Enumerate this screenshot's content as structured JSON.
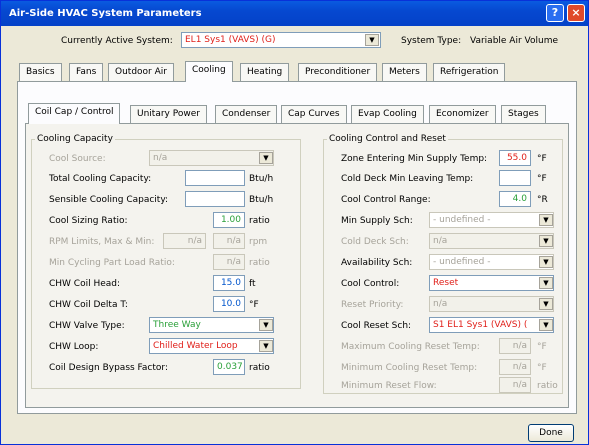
{
  "window": {
    "title": "Air-Side HVAC System Parameters",
    "help": "?",
    "close": "×"
  },
  "header": {
    "active_label": "Currently Active System:",
    "active_value": "EL1 Sys1 (VAVS) (G)",
    "type_label": "System Type:",
    "type_value": "Variable Air Volume"
  },
  "main_tabs": [
    "Basics",
    "Fans",
    "Outdoor Air",
    "Cooling",
    "Heating",
    "Preconditioner",
    "Meters",
    "Refrigeration"
  ],
  "sub_tabs": [
    "Coil Cap / Control",
    "Unitary Power",
    "Condenser",
    "Cap Curves",
    "Evap Cooling",
    "Economizer",
    "Stages"
  ],
  "left": {
    "title": "Cooling Capacity",
    "cool_source": {
      "label": "Cool Source:",
      "value": "n/a"
    },
    "total_cap": {
      "label": "Total Cooling Capacity:",
      "value": "",
      "unit": "Btu/h"
    },
    "sensible_cap": {
      "label": "Sensible Cooling Capacity:",
      "value": "",
      "unit": "Btu/h"
    },
    "sizing_ratio": {
      "label": "Cool Sizing Ratio:",
      "value": "1.00",
      "unit": "ratio"
    },
    "rpm": {
      "label": "RPM Limits, Max & Min:",
      "max": "n/a",
      "min": "n/a",
      "unit": "rpm"
    },
    "min_cycling": {
      "label": "Min Cycling Part Load Ratio:",
      "value": "n/a",
      "unit": "ratio"
    },
    "chw_head": {
      "label": "CHW Coil Head:",
      "value": "15.0",
      "unit": "ft"
    },
    "chw_delta": {
      "label": "CHW Coil Delta T:",
      "value": "10.0",
      "unit": "°F"
    },
    "valve": {
      "label": "CHW Valve Type:",
      "value": "Three Way"
    },
    "loop": {
      "label": "CHW Loop:",
      "value": "Chilled Water Loop"
    },
    "bypass": {
      "label": "Coil Design Bypass Factor:",
      "value": "0.037",
      "unit": "ratio"
    }
  },
  "right": {
    "title": "Cooling Control and Reset",
    "zone_min": {
      "label": "Zone Entering Min Supply Temp:",
      "value": "55.0",
      "unit": "°F"
    },
    "cold_deck_min": {
      "label": "Cold Deck Min Leaving Temp:",
      "value": "",
      "unit": "°F"
    },
    "range": {
      "label": "Cool Control Range:",
      "value": "4.0",
      "unit": "°R"
    },
    "min_supply_sch": {
      "label": "Min Supply Sch:",
      "value": "- undefined -"
    },
    "cold_deck_sch": {
      "label": "Cold Deck Sch:",
      "value": "n/a"
    },
    "avail_sch": {
      "label": "Availability Sch:",
      "value": "- undefined -"
    },
    "control": {
      "label": "Cool Control:",
      "value": "Reset"
    },
    "reset_priority": {
      "label": "Reset Priority:",
      "value": "n/a"
    },
    "reset_sch": {
      "label": "Cool Reset Sch:",
      "value": "S1 EL1 Sys1 (VAVS) ("
    },
    "max_reset": {
      "label": "Maximum Cooling Reset Temp:",
      "value": "n/a",
      "unit": "°F"
    },
    "min_reset": {
      "label": "Minimum Cooling Reset Temp:",
      "value": "n/a",
      "unit": "°F"
    },
    "min_flow": {
      "label": "Minimum Reset Flow:",
      "value": "n/a",
      "unit": "ratio"
    }
  },
  "footer": {
    "done": "Done"
  },
  "icons": {
    "dropdown": "▼"
  },
  "colors": {
    "title_bar": "#0648d0",
    "red_value": "#e0201a",
    "green_value": "#2aa039",
    "input_blue": "#0055cc"
  }
}
